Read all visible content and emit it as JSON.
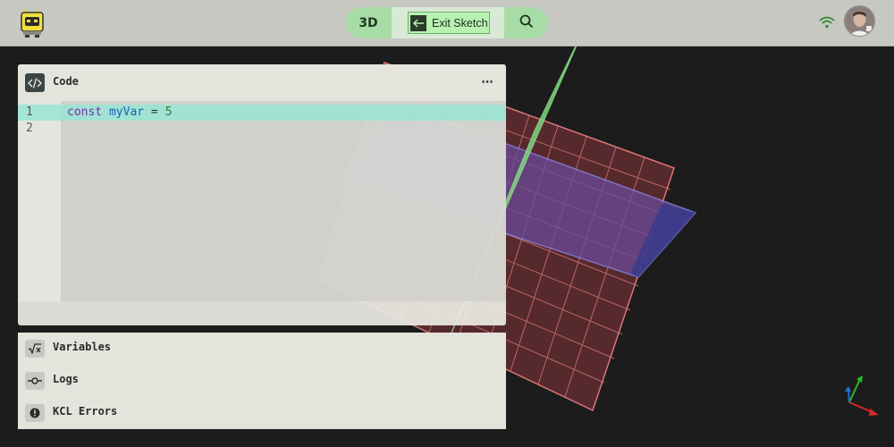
{
  "topbar": {
    "view_mode_label": "3D",
    "exit_sketch_label": "Exit Sketch",
    "icons": [
      "robot-logo-icon",
      "exit-arrow-icon",
      "search-icon",
      "wifi-icon",
      "user-avatar"
    ]
  },
  "code_panel": {
    "title": "Code",
    "more_label": "⋯",
    "lines": [
      {
        "number": "1",
        "keyword": "const",
        "name": "myVar",
        "operator": " = ",
        "value": "5"
      },
      {
        "number": "2",
        "text": ""
      }
    ]
  },
  "side_panels": [
    {
      "label": "Variables",
      "icon": "sqrt-x-icon"
    },
    {
      "label": "Logs",
      "icon": "commit-icon"
    },
    {
      "label": "KCL Errors",
      "icon": "alert-circle-icon"
    }
  ],
  "colors": {
    "topbar_bg": "#c8c8c3",
    "viewport_bg": "#1c1c1c",
    "pill_bg": "#a7dca6",
    "active_line": "#98e6d4",
    "plane_red": "#e07a7a",
    "plane_blue": "#6f6fe0",
    "plane_green": "#7adc7a"
  }
}
